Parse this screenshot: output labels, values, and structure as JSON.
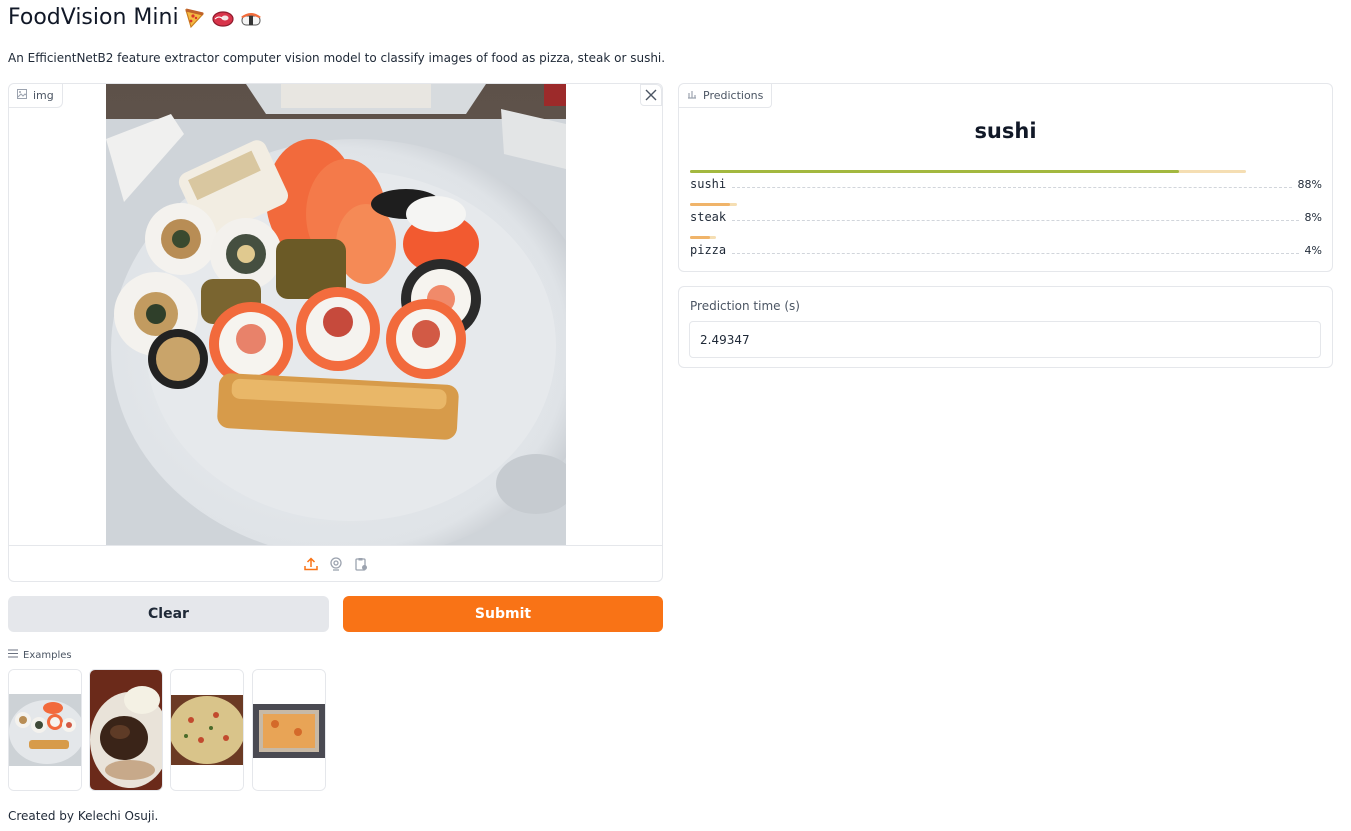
{
  "header": {
    "title": "FoodVision Mini",
    "emoji_icons": [
      "pizza-icon",
      "steak-icon",
      "sushi-icon"
    ],
    "subtitle": "An EfficientNetB2 feature extractor computer vision model to classify images of food as pizza, steak or sushi."
  },
  "image_input": {
    "label": "img",
    "toolbar_icons": [
      "upload-icon",
      "webcam-icon",
      "clipboard-icon"
    ]
  },
  "buttons": {
    "clear": "Clear",
    "submit": "Submit"
  },
  "examples": {
    "label": "Examples",
    "items": [
      "sushi-example",
      "steak-example",
      "pizza-example",
      "pizza-box-example"
    ]
  },
  "predictions": {
    "label": "Predictions",
    "top_label": "sushi",
    "confidences": [
      {
        "label": "sushi",
        "pct": "88%",
        "value": 0.88
      },
      {
        "label": "steak",
        "pct": "8%",
        "value": 0.08
      },
      {
        "label": "pizza",
        "pct": "4%",
        "value": 0.04
      }
    ]
  },
  "prediction_time": {
    "label": "Prediction time (s)",
    "value": "2.49347"
  },
  "footer": "Created by Kelechi Osuji.",
  "colors": {
    "accent": "#f97316",
    "bar_fill": "#a3b83f",
    "bar_track": "#f5deb3"
  }
}
